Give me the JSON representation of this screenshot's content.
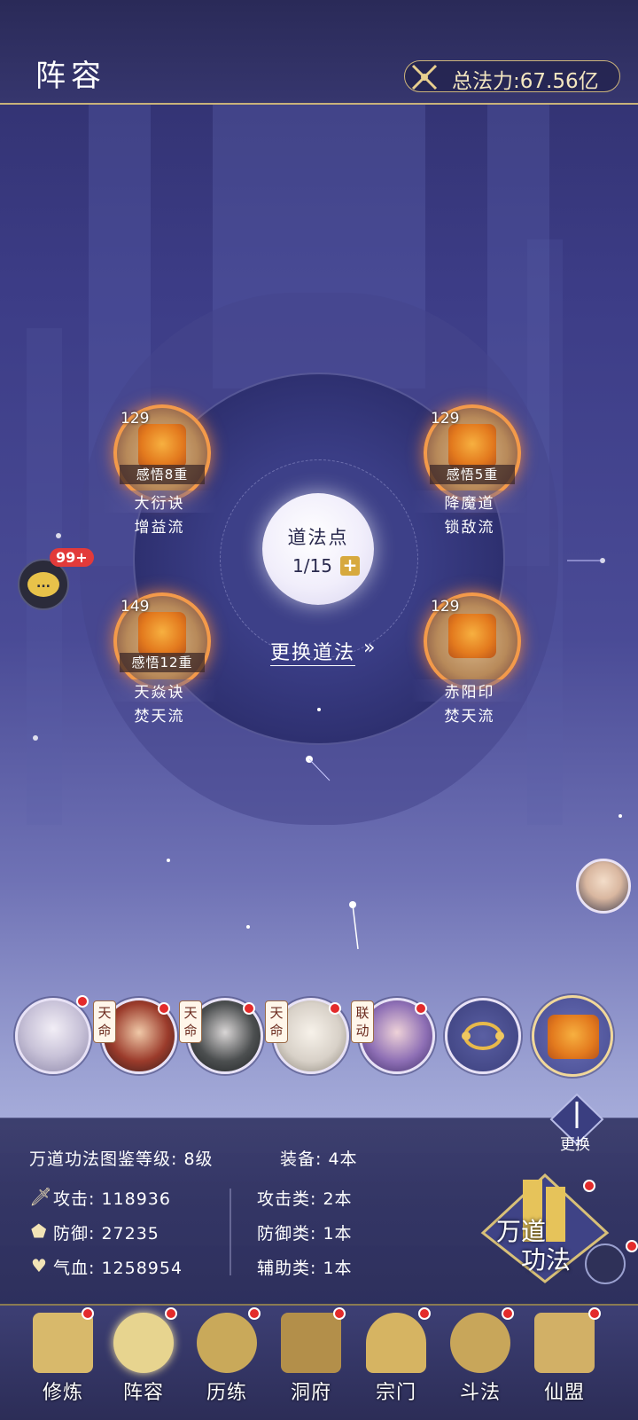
{
  "header": {
    "title": "阵容",
    "power_label": "总法力:67.56亿"
  },
  "center": {
    "label": "道法点",
    "count": "1/15",
    "plus": "+",
    "swap_link": "更换道法",
    "swap_arrow": "»"
  },
  "nodes": [
    {
      "level": "129",
      "insight": "感悟8重",
      "name": "大衍诀",
      "type": "增益流"
    },
    {
      "level": "129",
      "insight": "感悟5重",
      "name": "降魔道",
      "type": "锁敌流"
    },
    {
      "level": "149",
      "insight": "感悟12重",
      "name": "天焱诀",
      "type": "焚天流"
    },
    {
      "level": "129",
      "insight": "",
      "name": "赤阳印",
      "type": "焚天流"
    }
  ],
  "chat": {
    "badge": "99+",
    "icon": "..."
  },
  "roster": {
    "tags": [
      "天命",
      "天命",
      "天命",
      "联动"
    ]
  },
  "stats": {
    "handbook": "万道功法图鉴等级: 8级",
    "equip": "装备: 4本",
    "attack": "攻击: 118936",
    "defense": "防御: 27235",
    "hp": "气血: 1258954",
    "attack_type": "攻击类: 2本",
    "defense_type": "防御类: 1本",
    "support_type": "辅助类: 1本"
  },
  "wandao": {
    "line1": "万道",
    "line2": "功法"
  },
  "change_label": "更换",
  "nav": [
    {
      "label": "修炼"
    },
    {
      "label": "阵容"
    },
    {
      "label": "历练"
    },
    {
      "label": "洞府"
    },
    {
      "label": "宗门"
    },
    {
      "label": "斗法"
    },
    {
      "label": "仙盟"
    }
  ],
  "colors": {
    "accent_gold": "#cdb57c",
    "node_glow": "#f39a4a",
    "badge_red": "#e32b2b"
  }
}
